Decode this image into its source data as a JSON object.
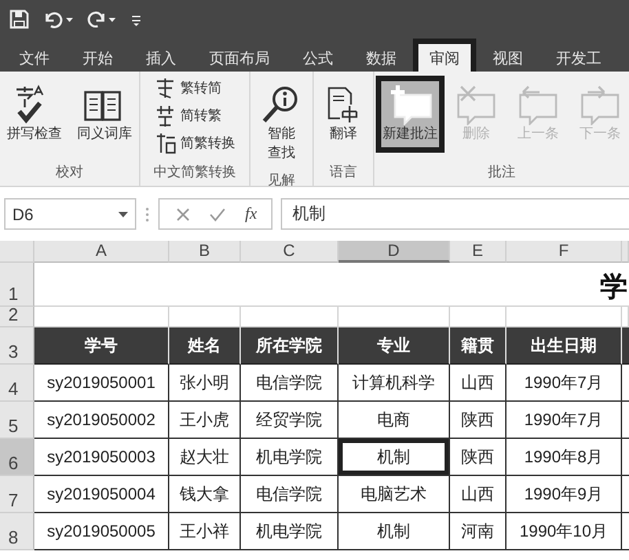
{
  "tabs": [
    {
      "label": "文件",
      "selected": false,
      "highlighted": false
    },
    {
      "label": "开始",
      "selected": false,
      "highlighted": false
    },
    {
      "label": "插入",
      "selected": false,
      "highlighted": false
    },
    {
      "label": "页面布局",
      "selected": false,
      "highlighted": false
    },
    {
      "label": "公式",
      "selected": false,
      "highlighted": false
    },
    {
      "label": "数据",
      "selected": false,
      "highlighted": false
    },
    {
      "label": "审阅",
      "selected": true,
      "highlighted": true
    },
    {
      "label": "视图",
      "selected": false,
      "highlighted": false
    },
    {
      "label": "开发工",
      "selected": false,
      "highlighted": false
    }
  ],
  "ribbon": {
    "groups": [
      {
        "label": "校对",
        "items": [
          {
            "kind": "large",
            "label": "拼写检查",
            "disabled": false,
            "highlighted": false
          },
          {
            "kind": "large",
            "label": "同义词库",
            "disabled": false,
            "highlighted": false
          }
        ]
      },
      {
        "label": "中文简繁转换",
        "items": [
          {
            "kind": "small",
            "label": "繁转简",
            "disabled": false,
            "highlighted": false
          },
          {
            "kind": "small",
            "label": "简转繁",
            "disabled": false,
            "highlighted": false
          },
          {
            "kind": "small",
            "label": "简繁转换",
            "disabled": false,
            "highlighted": false
          }
        ]
      },
      {
        "label": "见解",
        "items": [
          {
            "kind": "large",
            "label": "智能查找",
            "disabled": false,
            "highlighted": false
          }
        ]
      },
      {
        "label": "语言",
        "items": [
          {
            "kind": "large",
            "label": "翻译",
            "disabled": false,
            "highlighted": false
          }
        ]
      },
      {
        "label": "批注",
        "items": [
          {
            "kind": "large",
            "label": "新建批注",
            "disabled": false,
            "highlighted": true
          },
          {
            "kind": "large",
            "label": "删除",
            "disabled": true,
            "highlighted": false
          },
          {
            "kind": "large",
            "label": "上一条",
            "disabled": true,
            "highlighted": false
          },
          {
            "kind": "large",
            "label": "下一条",
            "disabled": true,
            "highlighted": false
          }
        ]
      }
    ]
  },
  "formula_bar": {
    "name_box": "D6",
    "function_label": "fx",
    "formula": "机制"
  },
  "sheet": {
    "columns": [
      {
        "label": "A",
        "selected": false
      },
      {
        "label": "B",
        "selected": false
      },
      {
        "label": "C",
        "selected": false
      },
      {
        "label": "D",
        "selected": true
      },
      {
        "label": "E",
        "selected": false
      },
      {
        "label": "F",
        "selected": false
      }
    ],
    "rows": [
      {
        "number": "1",
        "selected": false,
        "kind": "title",
        "cells": [
          "学"
        ]
      },
      {
        "number": "2",
        "selected": false,
        "kind": "blank",
        "cells": []
      },
      {
        "number": "3",
        "selected": false,
        "kind": "header",
        "cells": [
          "学号",
          "姓名",
          "所在学院",
          "专业",
          "籍贯",
          "出生日期"
        ]
      },
      {
        "number": "4",
        "selected": false,
        "kind": "data",
        "cells": [
          "sy2019050001",
          "张小明",
          "电信学院",
          "计算机科学",
          "山西",
          "1990年7月"
        ]
      },
      {
        "number": "5",
        "selected": false,
        "kind": "data",
        "cells": [
          "sy2019050002",
          "王小虎",
          "经贸学院",
          "电商",
          "陕西",
          "1990年7月"
        ]
      },
      {
        "number": "6",
        "selected": true,
        "kind": "data",
        "cells": [
          "sy2019050003",
          "赵大壮",
          "机电学院",
          "机制",
          "陕西",
          "1990年8月"
        ]
      },
      {
        "number": "7",
        "selected": false,
        "kind": "data",
        "cells": [
          "sy2019050004",
          "钱大拿",
          "电信学院",
          "电脑艺术",
          "山西",
          "1990年9月"
        ]
      },
      {
        "number": "8",
        "selected": false,
        "kind": "data",
        "cells": [
          "sy2019050005",
          "王小祥",
          "机电学院",
          "机制",
          "河南",
          "1990年10月"
        ]
      }
    ]
  }
}
